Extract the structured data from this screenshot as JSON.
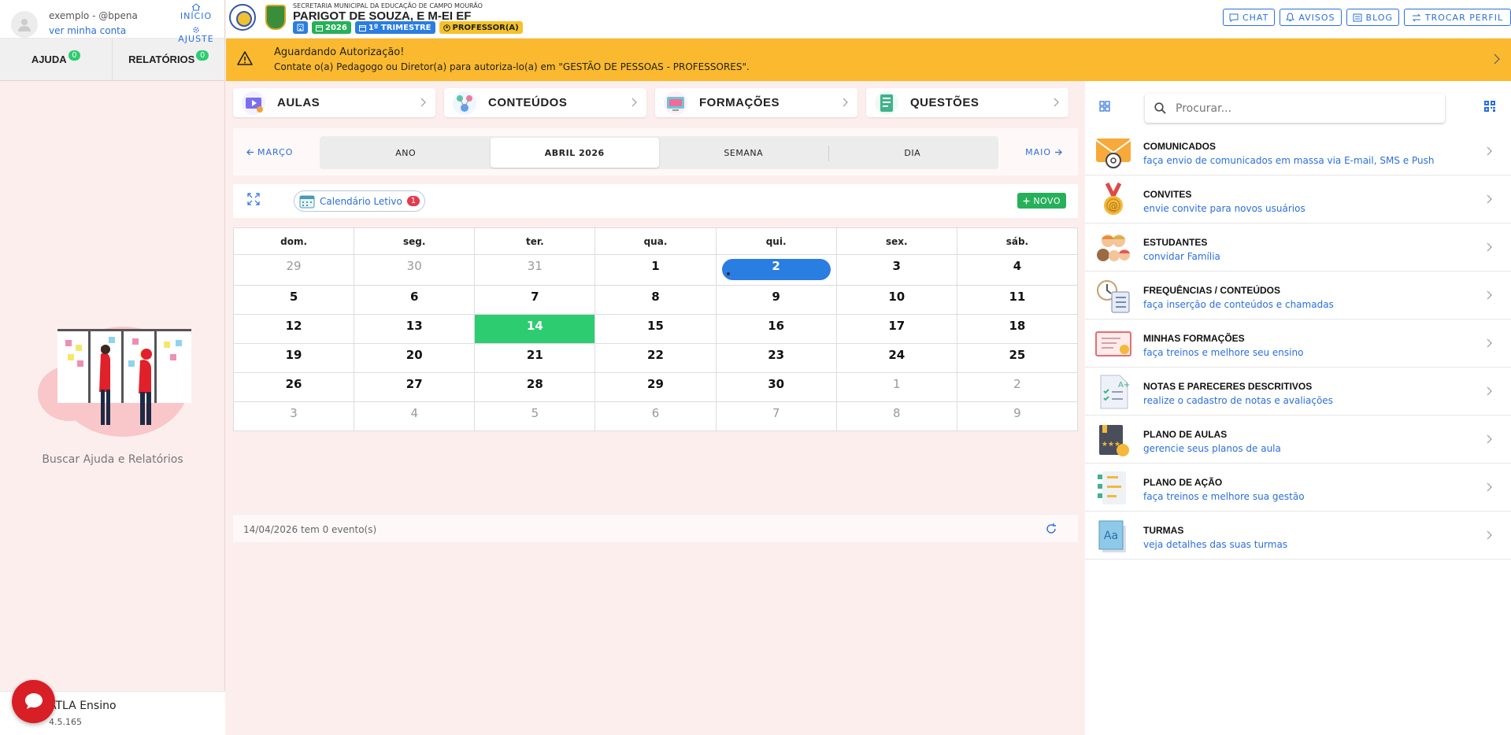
{
  "sidebar": {
    "user": "exemplo - @bpena",
    "account_link": "ver minha conta",
    "nav_home": "INÍCIO",
    "nav_settings": "AJUSTE",
    "tabs": [
      {
        "label": "AJUDA",
        "count": "0"
      },
      {
        "label": "RELATÓRIOS",
        "count": "0"
      }
    ],
    "empty_text": "Buscar Ajuda e Relatórios",
    "footer_name": "ATLA Ensino",
    "footer_version": "4.5.165"
  },
  "topbar": {
    "subtitle": "SECRETARIA MUNICIPAL DA EDUCAÇÃO DE CAMPO MOURÃO",
    "title": "PARIGOT DE SOUZA, E M-EI EF",
    "chip_year": "2026",
    "chip_term": "1º TRIMESTRE",
    "chip_role": "PROFESSOR(A)",
    "actions": [
      "CHAT",
      "AVISOS",
      "BLOG",
      "TROCAR PERFIL"
    ]
  },
  "alert": {
    "title": "Aguardando Autorização!",
    "message": "Contate o(a) Pedagogo ou Diretor(a) para autoriza-lo(a) em \"GESTÃO DE PESSOAS - PROFESSORES\"."
  },
  "shortcuts": [
    "AULAS",
    "CONTEÚDOS",
    "FORMAÇÕES",
    "QUESTÕES"
  ],
  "calendar_nav": {
    "prev": "MARÇO",
    "next": "MAIO",
    "views": [
      "ANO",
      "ABRIL 2026",
      "SEMANA",
      "DIA"
    ],
    "active_view": 1
  },
  "calendar_toolbar": {
    "chip_label": "Calendário Letivo",
    "chip_count": "1",
    "new_label": "NOVO"
  },
  "calendar": {
    "weekdays": [
      "dom.",
      "seg.",
      "ter.",
      "qua.",
      "qui.",
      "sex.",
      "sáb."
    ],
    "weeks": [
      [
        "29",
        "30",
        "31",
        "1",
        "2",
        "3",
        "4"
      ],
      [
        "5",
        "6",
        "7",
        "8",
        "9",
        "10",
        "11"
      ],
      [
        "12",
        "13",
        "14",
        "15",
        "16",
        "17",
        "18"
      ],
      [
        "19",
        "20",
        "21",
        "22",
        "23",
        "24",
        "25"
      ],
      [
        "26",
        "27",
        "28",
        "29",
        "30",
        "1",
        "2"
      ],
      [
        "3",
        "4",
        "5",
        "6",
        "7",
        "8",
        "9"
      ]
    ],
    "footer": "14/04/2026 tem 0 evento(s)"
  },
  "right_panel": {
    "search_placeholder": "Procurar...",
    "items": [
      {
        "title": "COMUNICADOS",
        "desc": "faça envio de comunicados em massa via E-mail, SMS e Push",
        "icon": "envelope-icon"
      },
      {
        "title": "CONVITES",
        "desc": "envie convite para novos usuários",
        "icon": "medal-icon"
      },
      {
        "title": "ESTUDANTES",
        "desc": "convidar Família",
        "icon": "students-icon"
      },
      {
        "title": "FREQUÊNCIAS / CONTEÚDOS",
        "desc": "faça inserção de conteúdos e chamadas",
        "icon": "attendance-icon"
      },
      {
        "title": "MINHAS FORMAÇÕES",
        "desc": "faça treinos e melhore seu ensino",
        "icon": "certificate-icon"
      },
      {
        "title": "NOTAS E PARECERES DESCRITIVOS",
        "desc": "realize o cadastro de notas e avaliações",
        "icon": "grades-icon"
      },
      {
        "title": "PLANO DE AULAS",
        "desc": "gerencie seus planos de aula",
        "icon": "lesson-plan-icon"
      },
      {
        "title": "PLANO DE AÇÃO",
        "desc": "faça treinos e melhore sua gestão",
        "icon": "action-plan-icon"
      },
      {
        "title": "TURMAS",
        "desc": "veja detalhes das suas turmas",
        "icon": "classes-icon"
      }
    ]
  },
  "colors": {
    "primary": "#2a6fdb",
    "alert": "#fbb92f",
    "today": "#2ecc71",
    "event": "#2a7de1",
    "chat_fab": "#d91f26"
  }
}
